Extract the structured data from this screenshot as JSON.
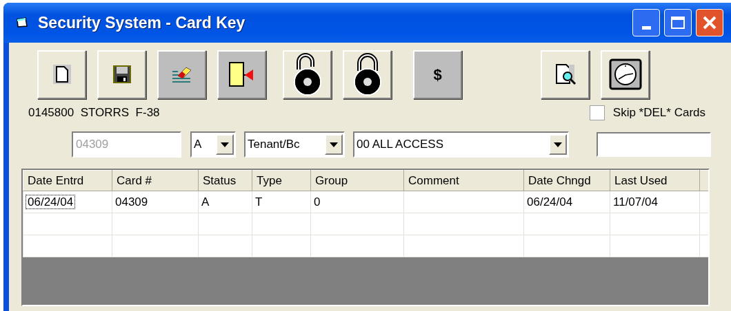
{
  "window": {
    "title": "Security System - Card Key"
  },
  "toolbar": [
    {
      "kind": "new",
      "highlighted": false
    },
    {
      "kind": "save",
      "highlighted": false
    },
    {
      "kind": "erase",
      "highlighted": true
    },
    {
      "kind": "exit",
      "highlighted": true
    },
    {
      "kind": "unlock",
      "highlighted": false
    },
    {
      "kind": "lock",
      "highlighted": false
    },
    {
      "label": "$",
      "highlighted": true
    },
    {
      "kind": "preview",
      "highlighted": false
    },
    {
      "kind": "clock",
      "highlighted": false
    }
  ],
  "account": "0145800  STORRS  F-38",
  "skip_del_cards": {
    "label": "Skip *DEL* Cards",
    "checked": false
  },
  "filters": {
    "card_number": {
      "value": "04309",
      "disabled": true
    },
    "status": "A",
    "type": "Tenant/Bc",
    "group": "00 ALL ACCESS"
  },
  "table": {
    "columns": [
      "Date Entrd",
      "Card #",
      "Status",
      "Type",
      "Group",
      "Comment",
      "Date Chngd",
      "Last Used"
    ],
    "rows": [
      [
        "06/24/04",
        "04309",
        "A",
        "T",
        "0",
        "",
        "06/24/04",
        "11/07/04"
      ]
    ]
  }
}
